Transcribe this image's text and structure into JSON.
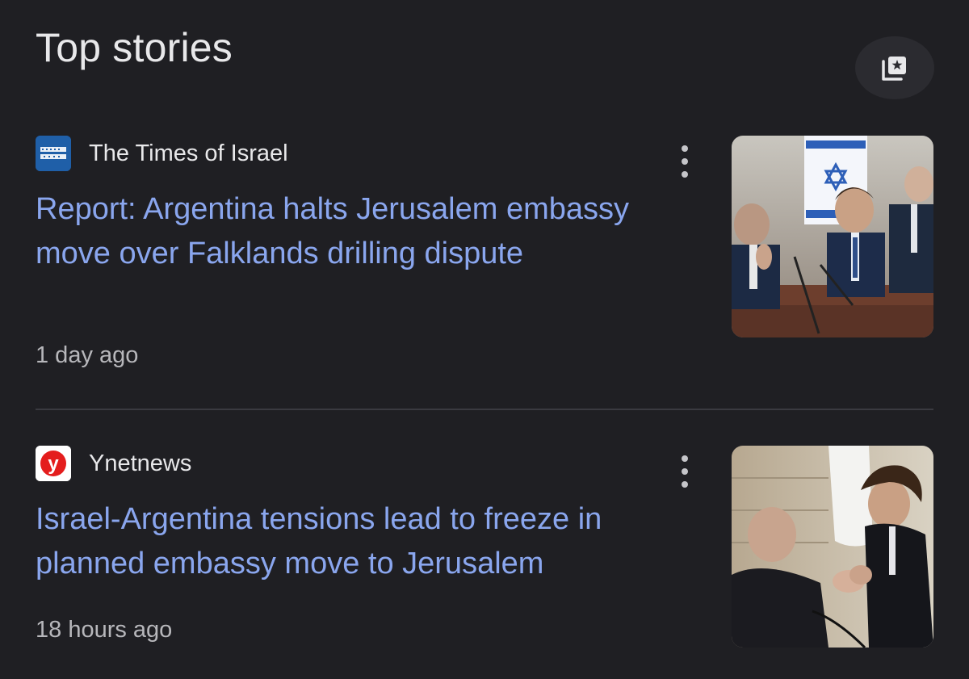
{
  "section": {
    "title": "Top stories",
    "save_icon": "saved-stories-icon"
  },
  "stories": [
    {
      "source": "The Times of Israel",
      "source_logo": "times-of-israel-logo",
      "headline": "Report: Argentina halts Jerusalem embassy move over Falklands drilling dispute",
      "time": "1 day ago",
      "thumbnail": "photo-leaders-at-podium-with-israeli-flag"
    },
    {
      "source": "Ynetnews",
      "source_logo": "ynetnews-logo",
      "headline": "Israel-Argentina tensions lead to freeze in planned embassy move to Jerusalem",
      "time": "18 hours ago",
      "thumbnail": "photo-leaders-shaking-hands"
    }
  ],
  "colors": {
    "background": "#1f1f23",
    "headline": "#8aa6ee",
    "text": "#e8e8ea",
    "muted": "#b7b7bb",
    "divider": "#3a3a40"
  }
}
